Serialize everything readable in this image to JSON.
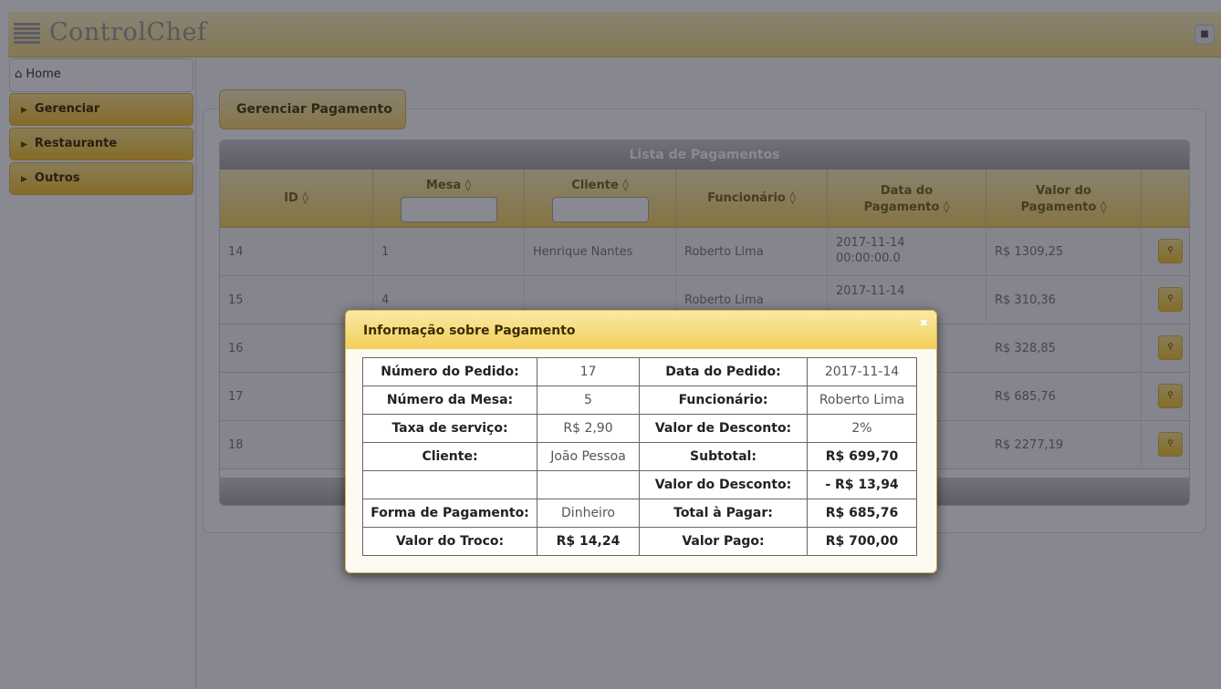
{
  "header": {
    "brand": "ControlChef",
    "user_icon": "user-icon",
    "menu_icon": "hamburger-icon"
  },
  "sidebar": {
    "items": [
      {
        "label": "Home",
        "icon": "home-icon"
      },
      {
        "label": "Gerenciar",
        "icon": "triangle-right-icon"
      },
      {
        "label": "Restaurante",
        "icon": "triangle-right-icon"
      },
      {
        "label": "Outros",
        "icon": "triangle-right-icon"
      }
    ]
  },
  "panel": {
    "legend": "Gerenciar Pagamento"
  },
  "grid": {
    "title": "Lista de Pagamentos",
    "columns": {
      "id": "ID ◊",
      "mesa": "Mesa ◊",
      "cliente": "Cliente ◊",
      "funcionario": "Funcionário ◊",
      "data_l1": "Data do",
      "data_l2": "Pagamento ◊",
      "valor_l1": "Valor do",
      "valor_l2": "Pagamento ◊"
    },
    "rows": [
      {
        "id": "14",
        "mesa": "1",
        "cliente": "Henrique Nantes",
        "funcionario": "Roberto Lima",
        "data_l1": "2017-11-14",
        "data_l2": "00:00:00.0",
        "valor": "R$ 1309,25"
      },
      {
        "id": "15",
        "mesa": "4",
        "cliente": "",
        "funcionario": "Roberto Lima",
        "data_l1": "2017-11-14",
        "data_l2": "",
        "valor": "R$ 310,36"
      },
      {
        "id": "16",
        "valor": "R$ 328,85"
      },
      {
        "id": "17",
        "valor": "R$ 685,76"
      },
      {
        "id": "18",
        "valor": "R$ 2277,19"
      }
    ]
  },
  "dialog": {
    "title": "Informação sobre Pagamento",
    "close_icon": "close-icon",
    "info": {
      "r1": {
        "k1": "Número do Pedido:",
        "v1": "17",
        "k2": "Data do Pedido:",
        "v2": "2017-11-14"
      },
      "r2": {
        "k1": "Número da Mesa:",
        "v1": "5",
        "k2": "Funcionário:",
        "v2": "Roberto Lima"
      },
      "r3": {
        "k1": "Taxa de serviço:",
        "v1": "R$ 2,90",
        "k2": "Valor de Desconto:",
        "v2": "2%"
      },
      "r4": {
        "k1": "Cliente:",
        "v1": "João Pessoa",
        "k2": "Subtotal:",
        "v2": "R$ 699,70"
      },
      "r5": {
        "k2": "Valor do Desconto:",
        "v2": "- R$ 13,94"
      },
      "r6": {
        "k1": "Forma de Pagamento:",
        "v1": "Dinheiro",
        "k2": "Total à Pagar:",
        "v2": "R$ 685,76"
      },
      "r7": {
        "k1": "Valor do Troco:",
        "v1": "R$ 14,24",
        "k2": "Valor Pago:",
        "v2": "R$ 700,00"
      }
    }
  }
}
